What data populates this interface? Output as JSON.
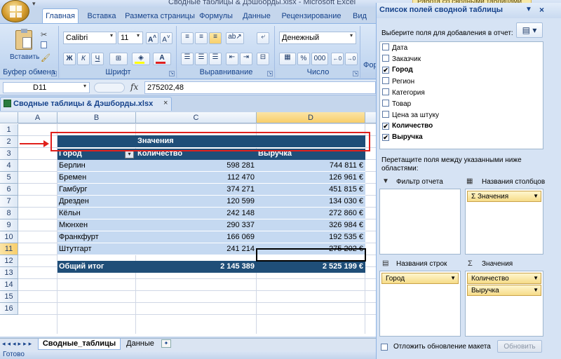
{
  "window": {
    "title": "Сводные таблицы & Дэшборды.xlsx - Microsoft Excel",
    "context_tab": "Работа со сводными таблицами"
  },
  "ribbon_tabs": [
    "Главная",
    "Вставка",
    "Разметка страницы",
    "Формулы",
    "Данные",
    "Рецензирование",
    "Вид"
  ],
  "ribbon": {
    "paste_label": "Вставить",
    "clipboard_label": "Буфер обмена",
    "font_name": "Calibri",
    "font_size": "11",
    "font_label": "Шрифт",
    "bold": "Ж",
    "italic": "К",
    "underline": "Ч",
    "alignment_label": "Выравнивание",
    "number_format": "Денежный",
    "number_label": "Число",
    "partial_label": "Фор",
    "percent": "%",
    "thousands": "000"
  },
  "formula_bar": {
    "name_box": "D11",
    "fx": "fx",
    "value": "275202,48"
  },
  "doc_tab": "Сводные таблицы & Дэшборды.xlsx",
  "columns": [
    "A",
    "B",
    "C",
    "D"
  ],
  "rows": [
    "1",
    "2",
    "3",
    "4",
    "5",
    "6",
    "7",
    "8",
    "9",
    "10",
    "11",
    "12",
    "13",
    "14",
    "15",
    "16"
  ],
  "pivot": {
    "values_header": "Значения",
    "headers": [
      "Город",
      "Количество",
      "Выручка"
    ],
    "data": [
      [
        "Берлин",
        "598 281",
        "744 811 €"
      ],
      [
        "Бремен",
        "112 470",
        "126 961 €"
      ],
      [
        "Гамбург",
        "374 271",
        "451 815 €"
      ],
      [
        "Дрезден",
        "120 599",
        "134 030 €"
      ],
      [
        "Кёльн",
        "242 148",
        "272 860 €"
      ],
      [
        "Мюнхен",
        "290 337",
        "326 984 €"
      ],
      [
        "Франкфурт",
        "166 069",
        "192 535 €"
      ],
      [
        "Штутгарт",
        "241 214",
        "275 202 €"
      ]
    ],
    "total": [
      "Общий итог",
      "2 145 389",
      "2 525 199 €"
    ]
  },
  "sheet_tabs": [
    "Сводные_таблицы",
    "Данные"
  ],
  "status": "Готово",
  "pane": {
    "title": "Список полей сводной таблицы",
    "choose_label": "Выберите поля для добавления в отчет:",
    "fields": [
      {
        "name": "Дата",
        "checked": false
      },
      {
        "name": "Заказчик",
        "checked": false
      },
      {
        "name": "Город",
        "checked": true
      },
      {
        "name": "Регион",
        "checked": false
      },
      {
        "name": "Категория",
        "checked": false
      },
      {
        "name": "Товар",
        "checked": false
      },
      {
        "name": "Цена за штуку",
        "checked": false
      },
      {
        "name": "Количество",
        "checked": true
      },
      {
        "name": "Выручка",
        "checked": true
      }
    ],
    "drag_label": "Перетащите поля между указанными ниже областями:",
    "filter_title": "Фильтр отчета",
    "columns_title": "Названия столбцов",
    "rows_title": "Названия строк",
    "values_title": "Значения",
    "columns_chip": "Σ  Значения",
    "rows_chip": "Город",
    "values_chips": [
      "Количество",
      "Выручка"
    ],
    "defer_label": "Отложить обновление макета",
    "update_button": "Обновить"
  },
  "colors": {
    "pivot_dark": "#1f4e78",
    "pivot_light": "#c5d9f1",
    "highlight": "#e0201c"
  }
}
